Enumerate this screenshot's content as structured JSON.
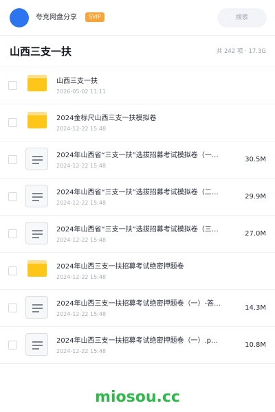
{
  "topbar": {
    "username": "夸克网盘分享",
    "badge": "SVIP",
    "search_placeholder": "搜索",
    "avatar_color": "#2c74f0"
  },
  "header": {
    "title": "山西三支一扶",
    "summary": "共 242 项 · 17.3G"
  },
  "items": [
    {
      "type": "folder",
      "icon": "folder-icon",
      "name": "山西三支一扶",
      "date": "2026-05-02 11:11",
      "size": ""
    },
    {
      "type": "folder",
      "icon": "folder-icon",
      "name": "2024金标尺山西三支一扶模拟卷",
      "date": "2024-12-22 15:48",
      "size": ""
    },
    {
      "type": "file",
      "icon": "document-icon",
      "name": "2024年山西省“三支一扶”选拔招募考试模拟卷（一…",
      "date": "2024-12-22 15:48",
      "size": "30.5M"
    },
    {
      "type": "file",
      "icon": "document-icon",
      "name": "2024年山西省“三支一扶”选拔招募考试模拟卷（二…",
      "date": "2024-12-22 15:48",
      "size": "29.9M"
    },
    {
      "type": "file",
      "icon": "document-icon",
      "name": "2024年山西省“三支一扶”选拔招募考试模拟卷（三…",
      "date": "2024-12-22 15:48",
      "size": "27.0M"
    },
    {
      "type": "folder",
      "icon": "folder-icon",
      "name": "2024年山西三支一扶招募考试绝密押题卷",
      "date": "2024-12-22 15:48",
      "size": ""
    },
    {
      "type": "file",
      "icon": "document-icon",
      "name": "2024年山西三支一扶招募考试绝密押题卷（一）-答…",
      "date": "2024-12-22 15:48",
      "size": "14.3M"
    },
    {
      "type": "file",
      "icon": "document-icon",
      "name": "2024年山西三支一扶招募考试绝密押题卷（一）.p…",
      "date": "2024-12-22 15:48",
      "size": "10.8M"
    }
  ],
  "watermark": "miosou.cc",
  "colors": {
    "accent": "#2c74f0",
    "svip": "#f7a53a",
    "folder": "#ffc61a",
    "watermark": "#2fb84a"
  }
}
